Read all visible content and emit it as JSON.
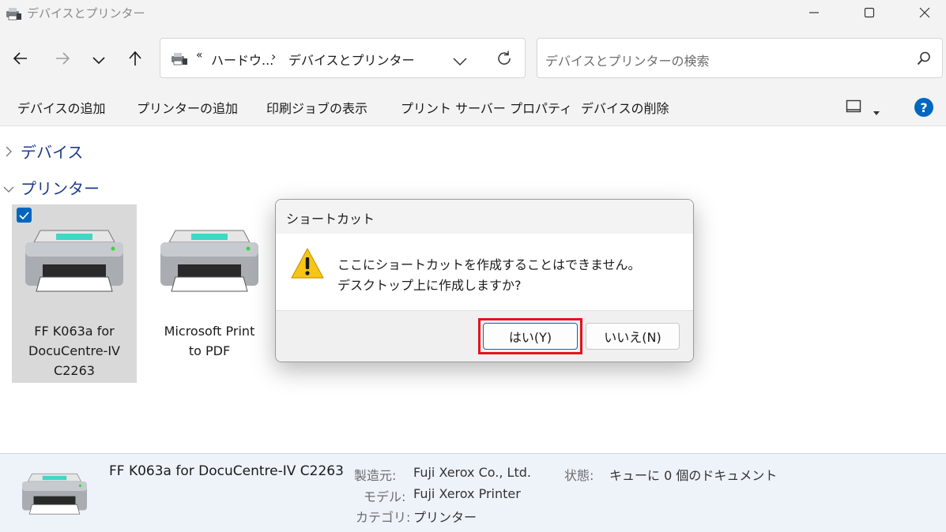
{
  "window": {
    "title": "デバイスとプリンター",
    "app_icon": "devices-printers-icon",
    "controls": [
      "minimize-icon",
      "maximize-icon",
      "close-icon"
    ]
  },
  "nav": {
    "back": "arrow-left-icon",
    "forward": "arrow-right-icon",
    "recent": "chevron-down-icon",
    "up": "arrow-up-icon",
    "breadcrumb": {
      "overflow": "«",
      "items": [
        "ハードウ...",
        "デバイスとプリンター"
      ],
      "separator": "›"
    },
    "refresh": "refresh-icon",
    "search_placeholder": "デバイスとプリンターの検索"
  },
  "commands": {
    "items": [
      "デバイスの追加",
      "プリンターの追加",
      "印刷ジョブの表示",
      "プリント サーバー プロパティ",
      "デバイスの削除"
    ],
    "view_icon": "view-options-icon",
    "help_label": "?"
  },
  "groups": [
    {
      "label": "デバイス",
      "expanded": false
    },
    {
      "label": "プリンター",
      "expanded": true
    }
  ],
  "printers": [
    {
      "name": "FF K063a for\nDocuCentre-IV\nC2263",
      "selected": true,
      "checked": true
    },
    {
      "name": "Microsoft Print\nto PDF",
      "selected": false,
      "checked": false
    }
  ],
  "details": {
    "name": "FF K063a for DocuCentre-IV C2263",
    "fields": [
      {
        "label": "製造元:",
        "value": "Fuji Xerox Co., Ltd."
      },
      {
        "label": "モデル:",
        "value": "Fuji Xerox Printer"
      },
      {
        "label": "カテゴリ:",
        "value": "プリンター"
      }
    ],
    "status_label": "状態:",
    "status_value": "キューに 0 個のドキュメント"
  },
  "dialog": {
    "title": "ショートカット",
    "icon": "warning-icon",
    "message_line1": "ここにショートカットを作成することはできません。",
    "message_line2": "デスクトップ上に作成しますか?",
    "yes_label": "はい(Y)",
    "no_label": "いいえ(N)",
    "highlight_color": "#e0141e"
  },
  "colors": {
    "accent": "#0067c0",
    "group_heading": "#1f3c8a",
    "selection_bg": "#d9d9d9",
    "details_bg": "#eef3fa",
    "warning_yellow": "#f6c516",
    "printer_tray_glow": "#3fd7c6"
  }
}
